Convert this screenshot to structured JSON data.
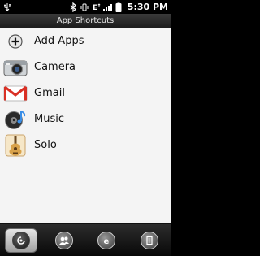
{
  "status_bar": {
    "time": "5:30 PM",
    "icons": [
      "usb-icon",
      "bluetooth-icon",
      "vibrate-icon",
      "edge-data-icon",
      "signal-icon",
      "battery-icon"
    ]
  },
  "title": "App Shortcuts",
  "items": [
    {
      "label": "Add Apps",
      "icon": "add-icon"
    },
    {
      "label": "Camera",
      "icon": "camera-icon"
    },
    {
      "label": "Gmail",
      "icon": "gmail-icon"
    },
    {
      "label": "Music",
      "icon": "music-icon"
    },
    {
      "label": "Solo",
      "icon": "guitar-icon"
    }
  ],
  "bottom_tabs": [
    {
      "icon": "app-shortcuts-tab-icon",
      "active": true
    },
    {
      "icon": "people-tab-icon",
      "active": false
    },
    {
      "icon": "browser-tab-icon",
      "active": false
    },
    {
      "icon": "bookmarks-tab-icon",
      "active": false
    }
  ],
  "colors": {
    "gmail_red": "#d93025",
    "guitar_wood": "#d9a24a"
  }
}
